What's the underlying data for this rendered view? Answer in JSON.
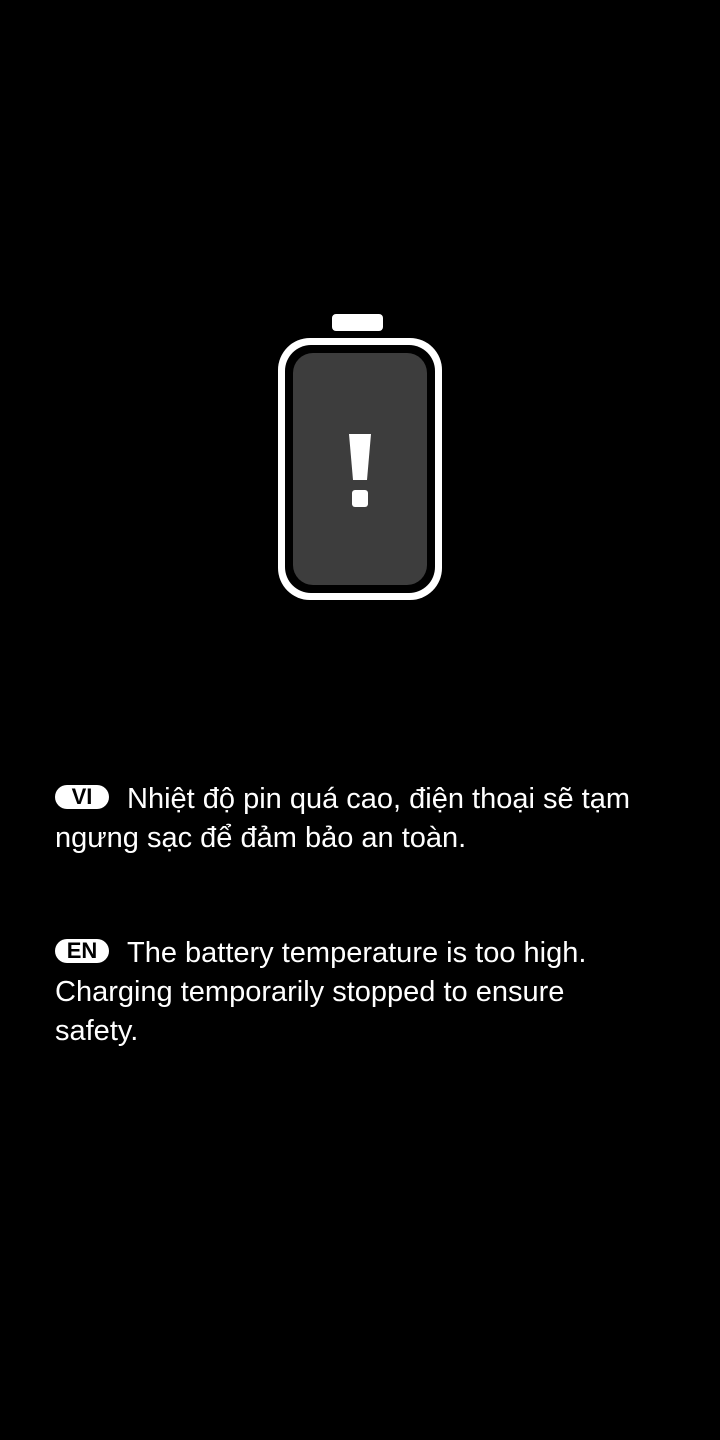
{
  "colors": {
    "background": "#000000",
    "text": "#ffffff",
    "battery_outline": "#ffffff",
    "battery_fill": "#3d3d3d"
  },
  "battery": {
    "icon": "battery-warning-icon",
    "glyph": "exclamation-icon"
  },
  "messages": [
    {
      "lang_badge": "VI",
      "text": "Nhiệt độ pin quá cao, điện thoại sẽ tạm ngưng sạc để đảm bảo an toàn."
    },
    {
      "lang_badge": "EN",
      "text": "The battery temperature is too high. Charging temporarily stopped to ensure safety."
    }
  ]
}
